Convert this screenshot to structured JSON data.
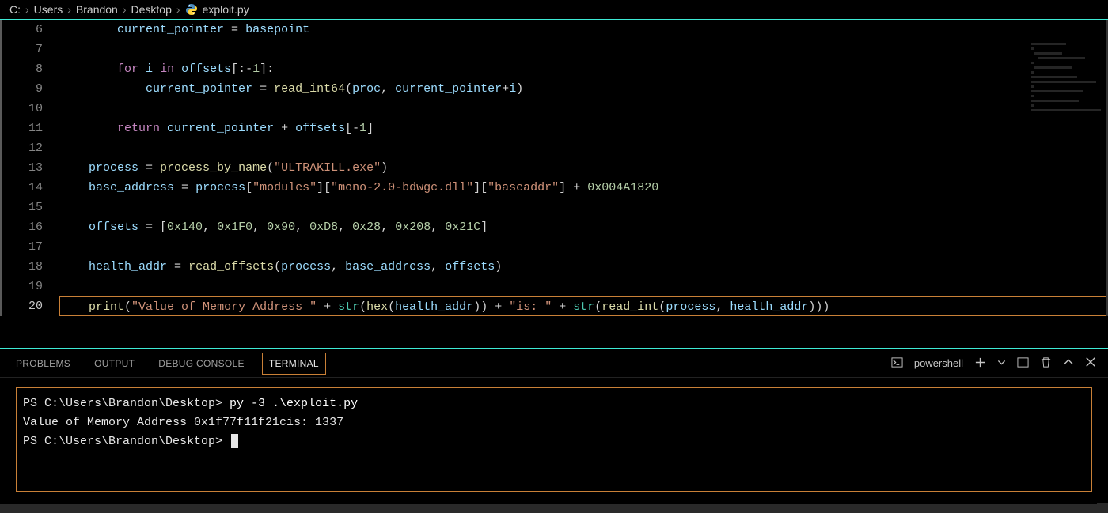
{
  "breadcrumb": {
    "segments": [
      "C:",
      "Users",
      "Brandon",
      "Desktop"
    ],
    "file": "exploit.py"
  },
  "editor": {
    "active_line": 20,
    "lines": [
      {
        "n": 6,
        "tokens": [
          {
            "pad": "        "
          },
          {
            "t": "current_pointer",
            "c": "var"
          },
          {
            "t": " = "
          },
          {
            "t": "basepoint",
            "c": "var"
          }
        ]
      },
      {
        "n": 7,
        "tokens": []
      },
      {
        "n": 8,
        "tokens": [
          {
            "pad": "        "
          },
          {
            "t": "for",
            "c": "kw"
          },
          {
            "t": " "
          },
          {
            "t": "i",
            "c": "var"
          },
          {
            "t": " "
          },
          {
            "t": "in",
            "c": "kw"
          },
          {
            "t": " "
          },
          {
            "t": "offsets",
            "c": "var"
          },
          {
            "t": "[:-"
          },
          {
            "t": "1",
            "c": "num"
          },
          {
            "t": "]:"
          }
        ]
      },
      {
        "n": 9,
        "tokens": [
          {
            "pad": "            "
          },
          {
            "t": "current_pointer",
            "c": "var"
          },
          {
            "t": " = "
          },
          {
            "t": "read_int64",
            "c": "fn"
          },
          {
            "t": "("
          },
          {
            "t": "proc",
            "c": "var"
          },
          {
            "t": ", "
          },
          {
            "t": "current_pointer",
            "c": "var"
          },
          {
            "t": "+"
          },
          {
            "t": "i",
            "c": "var"
          },
          {
            "t": ")"
          }
        ]
      },
      {
        "n": 10,
        "tokens": []
      },
      {
        "n": 11,
        "tokens": [
          {
            "pad": "        "
          },
          {
            "t": "return",
            "c": "kw"
          },
          {
            "t": " "
          },
          {
            "t": "current_pointer",
            "c": "var"
          },
          {
            "t": " + "
          },
          {
            "t": "offsets",
            "c": "var"
          },
          {
            "t": "[-"
          },
          {
            "t": "1",
            "c": "num"
          },
          {
            "t": "]"
          }
        ]
      },
      {
        "n": 12,
        "tokens": []
      },
      {
        "n": 13,
        "tokens": [
          {
            "pad": "    "
          },
          {
            "t": "process",
            "c": "var"
          },
          {
            "t": " = "
          },
          {
            "t": "process_by_name",
            "c": "fn"
          },
          {
            "t": "("
          },
          {
            "t": "\"ULTRAKILL.exe\"",
            "c": "str"
          },
          {
            "t": ")"
          }
        ]
      },
      {
        "n": 14,
        "tokens": [
          {
            "pad": "    "
          },
          {
            "t": "base_address",
            "c": "var"
          },
          {
            "t": " = "
          },
          {
            "t": "process",
            "c": "var"
          },
          {
            "t": "["
          },
          {
            "t": "\"modules\"",
            "c": "str"
          },
          {
            "t": "]["
          },
          {
            "t": "\"mono-2.0-bdwgc.dll\"",
            "c": "str"
          },
          {
            "t": "]["
          },
          {
            "t": "\"baseaddr\"",
            "c": "str"
          },
          {
            "t": "] + "
          },
          {
            "t": "0x004A1820",
            "c": "num"
          }
        ]
      },
      {
        "n": 15,
        "tokens": []
      },
      {
        "n": 16,
        "tokens": [
          {
            "pad": "    "
          },
          {
            "t": "offsets",
            "c": "var"
          },
          {
            "t": " = ["
          },
          {
            "t": "0x140",
            "c": "num"
          },
          {
            "t": ", "
          },
          {
            "t": "0x1F0",
            "c": "num"
          },
          {
            "t": ", "
          },
          {
            "t": "0x90",
            "c": "num"
          },
          {
            "t": ", "
          },
          {
            "t": "0xD8",
            "c": "num"
          },
          {
            "t": ", "
          },
          {
            "t": "0x28",
            "c": "num"
          },
          {
            "t": ", "
          },
          {
            "t": "0x208",
            "c": "num"
          },
          {
            "t": ", "
          },
          {
            "t": "0x21C",
            "c": "num"
          },
          {
            "t": "]"
          }
        ]
      },
      {
        "n": 17,
        "tokens": []
      },
      {
        "n": 18,
        "tokens": [
          {
            "pad": "    "
          },
          {
            "t": "health_addr",
            "c": "var"
          },
          {
            "t": " = "
          },
          {
            "t": "read_offsets",
            "c": "fn"
          },
          {
            "t": "("
          },
          {
            "t": "process",
            "c": "var"
          },
          {
            "t": ", "
          },
          {
            "t": "base_address",
            "c": "var"
          },
          {
            "t": ", "
          },
          {
            "t": "offsets",
            "c": "var"
          },
          {
            "t": ")"
          }
        ]
      },
      {
        "n": 19,
        "tokens": []
      },
      {
        "n": 20,
        "tokens": [
          {
            "pad": "    "
          },
          {
            "t": "print",
            "c": "fn"
          },
          {
            "t": "("
          },
          {
            "t": "\"Value of Memory Address \"",
            "c": "str"
          },
          {
            "t": " + "
          },
          {
            "t": "str",
            "c": "cls"
          },
          {
            "t": "("
          },
          {
            "t": "hex",
            "c": "fn"
          },
          {
            "t": "("
          },
          {
            "t": "health_addr",
            "c": "var"
          },
          {
            "t": ")) + "
          },
          {
            "t": "\"is: \"",
            "c": "str"
          },
          {
            "t": " + "
          },
          {
            "t": "str",
            "c": "cls"
          },
          {
            "t": "("
          },
          {
            "t": "read_int",
            "c": "fn"
          },
          {
            "t": "("
          },
          {
            "t": "process",
            "c": "var"
          },
          {
            "t": ", "
          },
          {
            "t": "health_addr",
            "c": "var"
          },
          {
            "t": ")))"
          }
        ]
      }
    ]
  },
  "panel": {
    "tabs": [
      "PROBLEMS",
      "OUTPUT",
      "DEBUG CONSOLE",
      "TERMINAL"
    ],
    "active_tab": "TERMINAL",
    "shell_label": "powershell"
  },
  "terminal": {
    "lines": [
      {
        "prompt": "PS C:\\Users\\Brandon\\Desktop> ",
        "cmd": "py -3 .\\exploit.py"
      },
      {
        "text": "Value of Memory Address 0x1f77f11f21cis: 1337"
      },
      {
        "prompt": "PS C:\\Users\\Brandon\\Desktop> ",
        "cursor": true
      }
    ]
  }
}
